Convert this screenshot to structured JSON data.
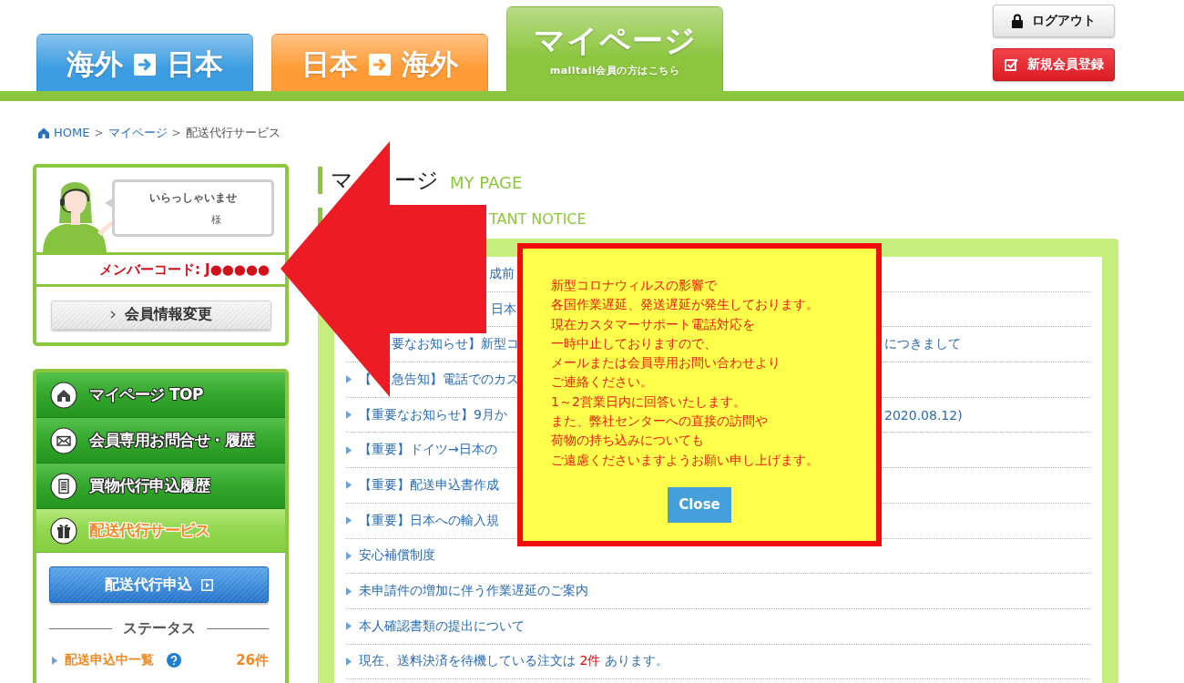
{
  "header": {
    "tabs": [
      {
        "kind": "route",
        "from": "海外",
        "to": "日本",
        "color": "#3d9de2",
        "selected": false
      },
      {
        "kind": "route",
        "from": "日本",
        "to": "海外",
        "color": "#ff9c37",
        "selected": false
      },
      {
        "kind": "mypage",
        "label": "マイページ",
        "sub": "malltail会員の方はこちら",
        "color": "#8cc63f",
        "selected": true
      }
    ],
    "account_buttons": [
      {
        "kind": "logout",
        "label": "ログアウト"
      },
      {
        "kind": "register",
        "label": "新規会員登録"
      }
    ]
  },
  "breadcrumb": [
    {
      "label": "HOME",
      "link": true
    },
    {
      "separator": ">",
      "label": "マイページ",
      "link": true
    },
    {
      "separator": ">",
      "label": "配送代行サービス",
      "link": false
    }
  ],
  "member_card": {
    "greeting": "いらっしゃいませ",
    "honorific": "様",
    "member_code": "メンバーコード: J●●●●●",
    "edit_button": "会員情報変更"
  },
  "nav": [
    {
      "kind": "home",
      "label": "マイページ TOP",
      "selected": false
    },
    {
      "kind": "mail",
      "label": "会員専用お問合せ・履歴",
      "selected": false
    },
    {
      "kind": "document",
      "label": "買物代行申込履歴",
      "selected": false
    },
    {
      "kind": "gift",
      "label": "配送代行サービス",
      "selected": true
    }
  ],
  "apply_button": "配送代行申込",
  "status": {
    "title": "ステータス",
    "rows": [
      {
        "label": "配送申込中一覧",
        "count": "26件"
      }
    ]
  },
  "main": {
    "title_parts": [
      "マ",
      "ージ"
    ],
    "title_en": "MY PAGE",
    "notice_heading_en": "TANT NOTICE",
    "notices": [
      {
        "bullet": false,
        "lead": "成前"
      },
      {
        "bullet": false,
        "lead": "日本"
      },
      {
        "bullet": false,
        "lead": "要なお知らせ】新型コ",
        "tail": "につきまして"
      },
      {
        "bullet": true,
        "prefix": "【",
        "lead": "急告知】電話でのカス"
      },
      {
        "bullet": true,
        "lead": "【重要なお知らせ】9月か",
        "tail": "2020.08.12)"
      },
      {
        "bullet": true,
        "lead": "【重要】ドイツ→日本の"
      },
      {
        "bullet": true,
        "lead": "【重要】配送申込書作成"
      },
      {
        "bullet": true,
        "lead": "【重要】日本への輸入規"
      },
      {
        "bullet": true,
        "lead": "安心補償制度"
      },
      {
        "bullet": true,
        "lead": "未申請件の増加に伴う作業遅延のご案内"
      },
      {
        "bullet": true,
        "lead": "本人確認書類の提出について"
      },
      {
        "bullet": true,
        "lead": "現在、送料決済を待機している注文は **2件** あります。"
      }
    ]
  },
  "annotation": {
    "kind": "arrow_left"
  },
  "popup": {
    "lines": [
      "新型コロナウィルスの影響で",
      "各国作業遅延、発送遅延が発生しております。",
      "現在カスタマーサポート電話対応を",
      "一時中止しておりますので、",
      "メールまたは会員専用お問い合わせより",
      "ご連絡ください。",
      "1～2営業日内に回答いたします。",
      "また、弊社センターへの直接の訪問や",
      "荷物の持ち込みについても",
      "ご遠慮くださいますようお願い申し上げます。"
    ],
    "close": "Close"
  }
}
